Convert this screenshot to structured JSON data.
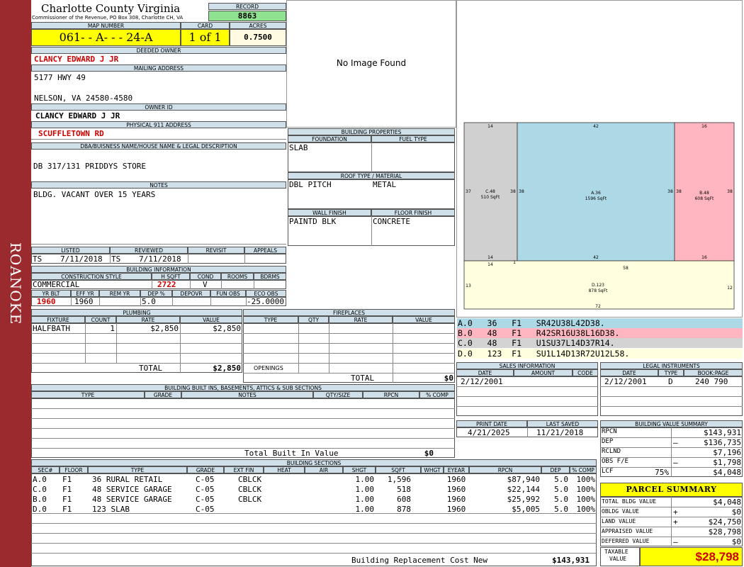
{
  "sidebar": {
    "text": "ROANOKE",
    "color": "#9b2a2e"
  },
  "header": {
    "county": "Charlotte County Virginia",
    "subtitle": "Commissioner of the Revenue, PO Box 308, Charlotte CH, VA",
    "record_label": "RECORD",
    "record": "8863"
  },
  "parcel": {
    "map_label": "MAP NUMBER",
    "map": "061- - A- - - 24-A",
    "card_label": "CARD",
    "card": "1 of 1",
    "acres_label": "ACRES",
    "acres": "0.7500"
  },
  "owner": {
    "deeded_label": "DEEDED OWNER",
    "deeded": "CLANCY EDWARD J JR",
    "mailing_label": "MAILING ADDRESS",
    "mail1": "5177 HWY 49",
    "mail2": "NELSON, VA 24580-4580",
    "owner_id_label": "OWNER ID",
    "owner_id": "CLANCY EDWARD J JR",
    "phys_label": "PHYSICAL 911 ADDRESS",
    "phys": "SCUFFLETOWN RD"
  },
  "legal": {
    "label": "DBA/BUISNESS NAME/HOUSE NAME & LEGAL DESCRIPTION",
    "text": "DB 317/131  PRIDDYS STORE"
  },
  "notes": {
    "label": "NOTES",
    "text": "BLDG. VACANT OVER 15 YEARS"
  },
  "review": {
    "listed_label": "LISTED",
    "listed_by": "TS",
    "listed": "7/11/2018",
    "reviewed_label": "REVIEWED",
    "reviewed_by": "TS",
    "reviewed": "7/11/2018",
    "revisit_label": "REVISIT",
    "appeals_label": "APPEALS"
  },
  "bldg_info": {
    "label": "BUILDING INFORMATION",
    "style_label": "CONSTRUCTION STYLE",
    "style": "COMMERCIAL",
    "hsqft_label": "H SQFT",
    "hsqft": "2722",
    "cond_label": "COND",
    "cond": "V",
    "rooms_label": "ROOMS",
    "bdrms_label": "BDRMS",
    "yrblt_label": "YR BLT",
    "yrblt": "1960",
    "effyr_label": "EFF YR",
    "effyr": "1960",
    "remyr_label": "REM YR",
    "dep_label": "DEP %",
    "dep": "5.0",
    "depovr_label": "DEPOVR",
    "funobs_label": "FUN OBS",
    "ecoobs_label": "ECO OBS",
    "ecoobs": "-25.0000"
  },
  "plumbing": {
    "label": "PLUMBING",
    "cols": [
      "FIXTURE",
      "COUNT",
      "RATE",
      "VALUE"
    ],
    "rows": [
      {
        "fixture": "HALFBATH",
        "count": "1",
        "rate": "$2,850",
        "value": "$2,850"
      }
    ],
    "total_label": "TOTAL",
    "total": "$2,850"
  },
  "fireplaces": {
    "label": "FIREPLACES",
    "cols": [
      "TYPE",
      "QTY",
      "RATE",
      "VALUE"
    ],
    "openings_label": "OPENINGS",
    "total_label": "TOTAL",
    "total": "$0"
  },
  "builtins": {
    "label": "BUILDING BUILT INS, BASEMENTS, ATTICS & SUB SECTIONS",
    "cols": [
      "TYPE",
      "GRADE",
      "NOTES",
      "QTY/SIZE",
      "RPCN",
      "% COMP"
    ],
    "total_label": "Total Built In Value",
    "total": "$0"
  },
  "photo": {
    "text": "No Image Found"
  },
  "bldg_props": {
    "label": "BUILDING PROPERTIES",
    "foundation_label": "FOUNDATION",
    "foundation": "SLAB",
    "fuel_label": "FUEL TYPE",
    "roof_label": "ROOF TYPE / MATERIAL",
    "roof_type": "DBL PITCH",
    "roof_mat": "METAL",
    "wall_label": "WALL FINISH",
    "wall": "PAINTD BLK",
    "floor_label": "FLOOR FINISH",
    "floor": "CONCRETE"
  },
  "sketch": {
    "areas": [
      {
        "id": "C.48",
        "sqft": "510 SqFt",
        "top": "14",
        "bottom": "14",
        "left": "37",
        "right": "38",
        "color": "#d0d0d0"
      },
      {
        "id": "A.36",
        "sqft": "1596 SqFt",
        "top": "42",
        "bottom": "42",
        "left": "38",
        "right": "38",
        "color": "#add8e6"
      },
      {
        "id": "B.48",
        "sqft": "608 SqFt",
        "top": "16",
        "bottom": "16",
        "left": "38",
        "right": "38",
        "color": "#ffb6c1"
      },
      {
        "id": "D.123",
        "sqft": "878 SqFt",
        "top": "14",
        "top2": "1",
        "top3": "58",
        "bottom": "72",
        "left": "13",
        "right": "12",
        "color": "#ffffe0"
      }
    ]
  },
  "vectors": [
    {
      "text": "A.0   36   F1   SR42U38L42D38.",
      "color": "#add8e6"
    },
    {
      "text": "B.0   48   F1   R42SR16U38L16D38.",
      "color": "#ffb6c1"
    },
    {
      "text": "C.0   48   F1   U1SU37L14D37R14.",
      "color": "#d3d3d3"
    },
    {
      "text": "D.0   123  F1   SU1L14D13R72U12L58.",
      "color": "#ffffe0"
    }
  ],
  "sales": {
    "label": "SALES INFORMATION",
    "cols": [
      "DATE",
      "AMOUNT",
      "CODE"
    ],
    "rows": [
      {
        "date": "2/12/2001",
        "amount": "",
        "code": ""
      }
    ]
  },
  "legal_inst": {
    "label": "LEGAL INSTRUMENTS",
    "cols": [
      "DATE",
      "TYPE",
      "BOOK:PAGE"
    ],
    "rows": [
      {
        "date": "2/12/2001",
        "type": "D",
        "bookpage": "240 790"
      }
    ]
  },
  "dates": {
    "print_label": "PRINT DATE",
    "print": "4/21/2025",
    "saved_label": "LAST SAVED",
    "saved": "11/21/2018"
  },
  "value_summary": {
    "label": "BUILDING VALUE SUMMARY",
    "rows": [
      {
        "label": "RPCN",
        "sign": "",
        "value": "$143,931"
      },
      {
        "label": "DEP",
        "sign": "–",
        "value": "$136,735"
      },
      {
        "label": "RCLND",
        "sign": "",
        "value": "$7,196"
      },
      {
        "label": "OBS F/E",
        "sign": "–",
        "value": "$1,798"
      },
      {
        "label": "LCF",
        "pct": "75%",
        "sign": "",
        "value": "$4,048"
      }
    ]
  },
  "parcel_summary": {
    "label": "PARCEL SUMMARY",
    "rows": [
      {
        "label": "TOTAL BLDG VALUE",
        "sign": "",
        "value": "$4,048"
      },
      {
        "label": "OBLDG VALUE",
        "sign": "+",
        "value": "$0"
      },
      {
        "label": "LAND VALUE",
        "sign": "+",
        "value": "$24,750"
      },
      {
        "label": "APPRAISED VALUE",
        "sign": "",
        "value": "$28,798"
      },
      {
        "label": "DEFERRED VALUE",
        "sign": "–",
        "value": "$0"
      }
    ],
    "taxable_label1": "TAXABLE",
    "taxable_label2": "VALUE",
    "taxable": "$28,798"
  },
  "sections": {
    "label": "BUILDING SECTIONS",
    "cols": [
      "SEC#",
      "FLOOR",
      "TYPE",
      "GRADE",
      "EXT FIN",
      "HEAT",
      "AIR",
      "SHGT",
      "SQFT",
      "WHGT",
      "EYEAR",
      "RPCN",
      "DEP",
      "% COMP"
    ],
    "rows": [
      {
        "sec": "A.0",
        "floor": "F1",
        "type": "36 RURAL RETAIL",
        "grade": "C-05",
        "ext": "CBLCK",
        "shgt": "1.00",
        "sqft": "1,596",
        "eyear": "1960",
        "rpcn": "$87,940",
        "dep": "5.0",
        "comp": "100%"
      },
      {
        "sec": "C.0",
        "floor": "F1",
        "type": "48 SERVICE GARAGE",
        "grade": "C-05",
        "ext": "CBLCK",
        "shgt": "1.00",
        "sqft": "518",
        "eyear": "1960",
        "rpcn": "$22,144",
        "dep": "5.0",
        "comp": "100%"
      },
      {
        "sec": "B.0",
        "floor": "F1",
        "type": "48 SERVICE GARAGE",
        "grade": "C-05",
        "ext": "CBLCK",
        "shgt": "1.00",
        "sqft": "608",
        "eyear": "1960",
        "rpcn": "$25,992",
        "dep": "5.0",
        "comp": "100%"
      },
      {
        "sec": "D.0",
        "floor": "F1",
        "type": "123 SLAB",
        "grade": "C-05",
        "ext": "",
        "shgt": "1.00",
        "sqft": "878",
        "eyear": "1960",
        "rpcn": "$5,005",
        "dep": "5.0",
        "comp": "100%"
      }
    ],
    "total_label": "Building Replacement Cost New",
    "total": "$143,931"
  }
}
